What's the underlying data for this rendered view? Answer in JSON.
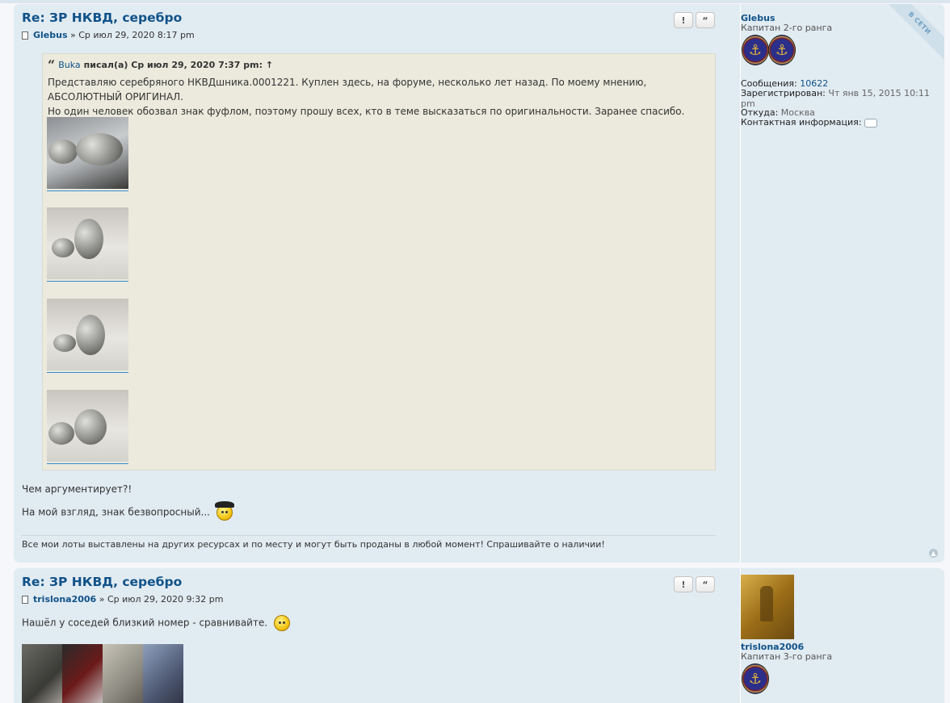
{
  "post1": {
    "title": "Re: ЗР НКВД, серебро",
    "author": "Glebus",
    "meta_sep": " » ",
    "date": "Ср июл 29, 2020 8:17 pm",
    "btn_report": "!",
    "btn_quote": "“",
    "quote": {
      "author": "Buka",
      "wrote": "писал(а) Ср июл 29, 2020 7:37 pm: ↑",
      "line1": "Представляю серебряного НКВДшника.0001221. Куплен здесь, на форуме, несколько лет назад. По моему мнению, АБСОЛЮТНЫЙ ОРИГИНАЛ.",
      "line2": "Но один человек обозвал знак фуфлом, поэтому прошу всех, кто в теме высказаться по оригинальности. Заранее спасибо."
    },
    "body_line1": "Чем аргументирует?!",
    "body_line2": "На мой взгляд, знак безвопросный...",
    "signature": "Все мои лоты выставлены на других ресурсах и по месту и могут быть проданы в любой момент! Спрашивайте о наличии!",
    "profile": {
      "name": "Glebus",
      "rank": "Капитан 2-го ранга",
      "online": "В СЕТИ",
      "posts_label": "Сообщения:",
      "posts_value": "10622",
      "registered_label": "Зарегистрирован:",
      "registered_value": "Чт янв 15, 2015 10:11 pm",
      "from_label": "Откуда:",
      "from_value": "Москва",
      "contact_label": "Контактная информация:"
    }
  },
  "post2": {
    "title": "Re: ЗР НКВД, серебро",
    "author": "trislona2006",
    "meta_sep": " » ",
    "date": "Ср июл 29, 2020 9:32 pm",
    "btn_report": "!",
    "btn_quote": "“",
    "body_line1": "Нашёл у соседей близкий номер - сравнивайте.",
    "profile": {
      "name": "trislona2006",
      "rank": "Капитан 3-го ранга"
    }
  },
  "icons": {
    "post_icon": "document-icon",
    "rank_icon": "anchor-icon",
    "smiley": "smiley-icon",
    "quote_icon": "quote-icon"
  },
  "colors": {
    "post_bg": "#e1ebf2",
    "quote_bg": "#ebeadd",
    "link": "#105289"
  }
}
